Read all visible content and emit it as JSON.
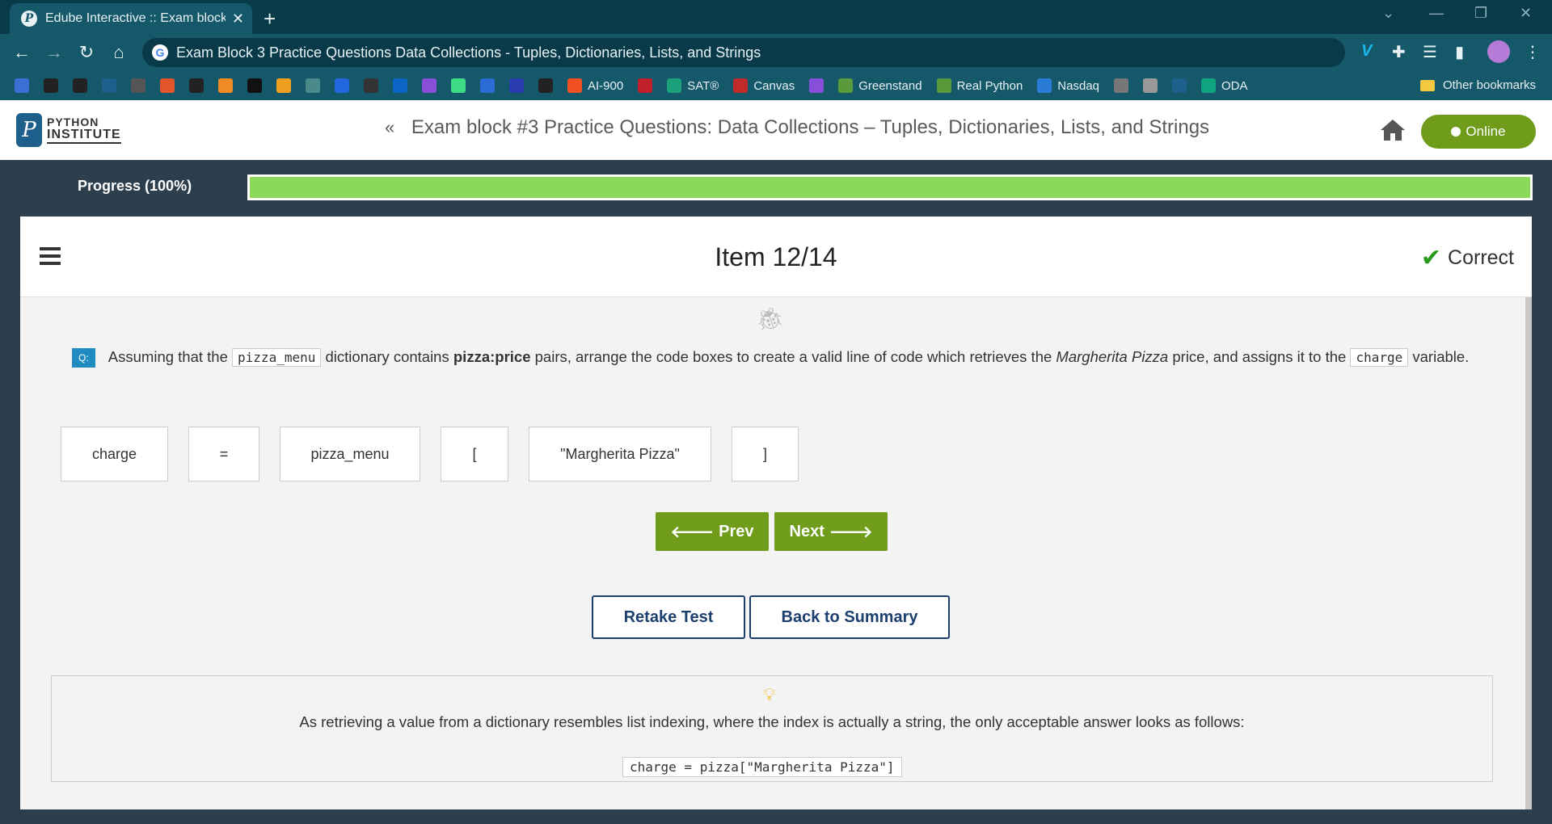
{
  "browser": {
    "tab_title": "Edube Interactive :: Exam block #",
    "url_text": "Exam Block 3 Practice Questions Data Collections - Tuples, Dictionaries, Lists, and Strings",
    "bookmarks": [
      {
        "icon": "layers-icon",
        "label": "",
        "color": "#3b6fd6"
      },
      {
        "icon": "github-icon",
        "label": "",
        "color": "#222222"
      },
      {
        "icon": "circle-logo-icon",
        "label": "",
        "color": "#222222"
      },
      {
        "icon": "square-app-icon",
        "label": "",
        "color": "#1f5f8b"
      },
      {
        "icon": "printer-icon",
        "label": "",
        "color": "#555555"
      },
      {
        "icon": "swirl-icon",
        "label": "",
        "color": "#e0552b"
      },
      {
        "icon": "lambda-icon",
        "label": "",
        "color": "#222222"
      },
      {
        "icon": "slash-icon",
        "label": "",
        "color": "#f08a24"
      },
      {
        "icon": "hr-icon",
        "label": "",
        "color": "#111111"
      },
      {
        "icon": "leaf-icon",
        "label": "",
        "color": "#f0a020"
      },
      {
        "icon": "dots-icon",
        "label": "",
        "color": "#4a8a8a"
      },
      {
        "icon": "c-icon",
        "label": "",
        "color": "#2266dd"
      },
      {
        "icon": "edx-icon",
        "label": "",
        "color": "#333333"
      },
      {
        "icon": "linkedin-icon",
        "label": "",
        "color": "#0a66c2"
      },
      {
        "icon": "u-icon",
        "label": "",
        "color": "#8a4fd8"
      },
      {
        "icon": "android-icon",
        "label": "",
        "color": "#3ddc84"
      },
      {
        "icon": "code-icon",
        "label": "",
        "color": "#2a6bd6"
      },
      {
        "icon": "h-icon",
        "label": "",
        "color": "#2a3bb0"
      },
      {
        "icon": "terminal-icon",
        "label": "",
        "color": "#222222"
      },
      {
        "icon": "microsoft-icon",
        "label": "AI-900",
        "color": "#f25022"
      },
      {
        "icon": "shield-icon",
        "label": "",
        "color": "#c0202a"
      },
      {
        "icon": "sat-icon",
        "label": "SAT®",
        "color": "#1aa07a"
      },
      {
        "icon": "canvas-icon",
        "label": "Canvas",
        "color": "#c22b2b"
      },
      {
        "icon": "ed-icon",
        "label": "",
        "color": "#8a4fd8"
      },
      {
        "icon": "slack-icon",
        "label": "Greenstand",
        "color": "#5a9a3a"
      },
      {
        "icon": "slack-icon",
        "label": "Real Python",
        "color": "#5a9a3a"
      },
      {
        "icon": "chart-line-icon",
        "label": "Nasdaq",
        "color": "#2a7bd6"
      },
      {
        "icon": "aai-icon",
        "label": "",
        "color": "#777777"
      },
      {
        "icon": "mw-icon",
        "label": "",
        "color": "#999999"
      },
      {
        "icon": "p-icon",
        "label": "",
        "color": "#1f5f8b"
      },
      {
        "icon": "openai-icon",
        "label": "ODA",
        "color": "#10a37f"
      }
    ],
    "other_bookmarks": "Other bookmarks"
  },
  "header": {
    "logo_line1": "PYTHON",
    "logo_line2": "INSTITUTE",
    "breadcrumb": "Exam block #3 Practice Questions: Data Collections – Tuples, Dictionaries, Lists, and Strings",
    "online_label": "Online"
  },
  "progress": {
    "label": "Progress (100%)",
    "percent": 100
  },
  "item": {
    "title": "Item 12/14",
    "status": "Correct",
    "question": {
      "badge": "Q:",
      "t1": "Assuming that the",
      "code1": "pizza_menu",
      "t2": "dictionary contains",
      "bold": "pizza:price",
      "t3": "pairs, arrange the code boxes to create a valid line of code which retrieves the",
      "italic": "Margherita Pizza",
      "t4": "price, and assigns it to the",
      "code2": "charge",
      "t5": "variable."
    },
    "code_boxes": [
      "charge",
      "=",
      "pizza_menu",
      "[",
      "\"Margherita Pizza\"",
      "]"
    ],
    "prev_label": "Prev",
    "next_label": "Next",
    "retake_label": "Retake Test",
    "summary_label": "Back to Summary",
    "explanation": "As retrieving a value from a dictionary resembles list indexing, where the index is actually a string, the only acceptable answer looks as follows:",
    "explanation_code": "charge = pizza[\"Margherita Pizza\"]"
  }
}
